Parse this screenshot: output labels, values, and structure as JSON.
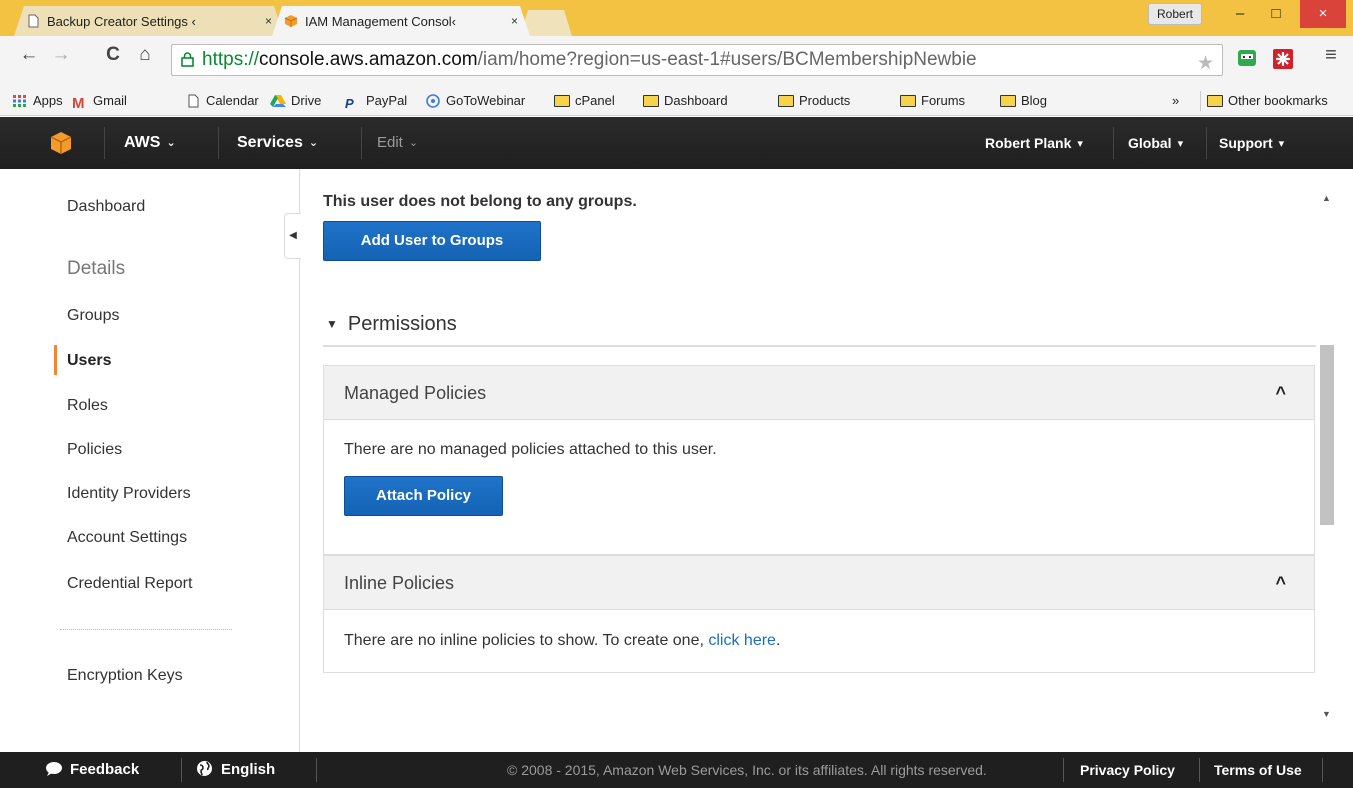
{
  "browser": {
    "tabs": [
      {
        "title": "Backup Creator Settings ‹",
        "close": "×"
      },
      {
        "title": "IAM Management Consol‹",
        "close": "×"
      }
    ],
    "profile": "Robert",
    "window_controls": {
      "minimize": "–",
      "maximize": "□",
      "close": "×"
    },
    "url": {
      "scheme": "https://",
      "host": "console.aws.amazon.com",
      "path": "/iam/home?region=us-east-1#users/BCMembershipNewbie"
    },
    "bookmarks": [
      {
        "label": "Apps",
        "icon": "apps-grid-icon"
      },
      {
        "label": "Gmail",
        "icon": "gmail-icon"
      },
      {
        "label": "Calendar",
        "icon": "page-icon"
      },
      {
        "label": "Drive",
        "icon": "drive-icon"
      },
      {
        "label": "PayPal",
        "icon": "paypal-icon"
      },
      {
        "label": "GoToWebinar",
        "icon": "gotowebinar-icon"
      },
      {
        "label": "cPanel",
        "icon": "folder-icon"
      },
      {
        "label": "Dashboard",
        "icon": "folder-icon"
      },
      {
        "label": "Products",
        "icon": "folder-icon"
      },
      {
        "label": "Forums",
        "icon": "folder-icon"
      },
      {
        "label": "Blog",
        "icon": "folder-icon"
      }
    ],
    "bookmarks_overflow": "»",
    "other_bookmarks": "Other bookmarks"
  },
  "aws_nav": {
    "aws": "AWS",
    "services": "Services",
    "edit": "Edit",
    "user": "Robert Plank",
    "region": "Global",
    "support": "Support",
    "caret": "⌄"
  },
  "sidebar": {
    "dashboard": "Dashboard",
    "details_heading": "Details",
    "items": [
      "Groups",
      "Users",
      "Roles",
      "Policies",
      "Identity Providers",
      "Account Settings",
      "Credential Report"
    ],
    "active_item": "Users",
    "encryption_keys": "Encryption Keys",
    "collapse_arrow": "◀"
  },
  "main": {
    "no_groups_text": "This user does not belong to any groups.",
    "add_to_groups_button": "Add User to Groups",
    "permissions_heading": "Permissions",
    "permissions_arrow": "▼",
    "managed_policies": {
      "title": "Managed Policies",
      "empty_text": "There are no managed policies attached to this user.",
      "attach_button": "Attach Policy"
    },
    "inline_policies": {
      "title": "Inline Policies",
      "empty_text": "There are no inline policies to show. To create one,",
      "link_text": "click here",
      "trailing": "."
    },
    "panel_chevron": "^"
  },
  "footer": {
    "feedback": "Feedback",
    "language": "English",
    "copyright": "© 2008 - 2015, Amazon Web Services, Inc. or its affiliates. All rights reserved.",
    "privacy": "Privacy Policy",
    "terms": "Terms of Use"
  },
  "colors": {
    "accent_orange": "#f58536",
    "button_blue": "#1f73c9",
    "link_blue": "#1a6fc0",
    "nav_dark": "#232323",
    "tabbar_yellow": "#f3c242"
  }
}
